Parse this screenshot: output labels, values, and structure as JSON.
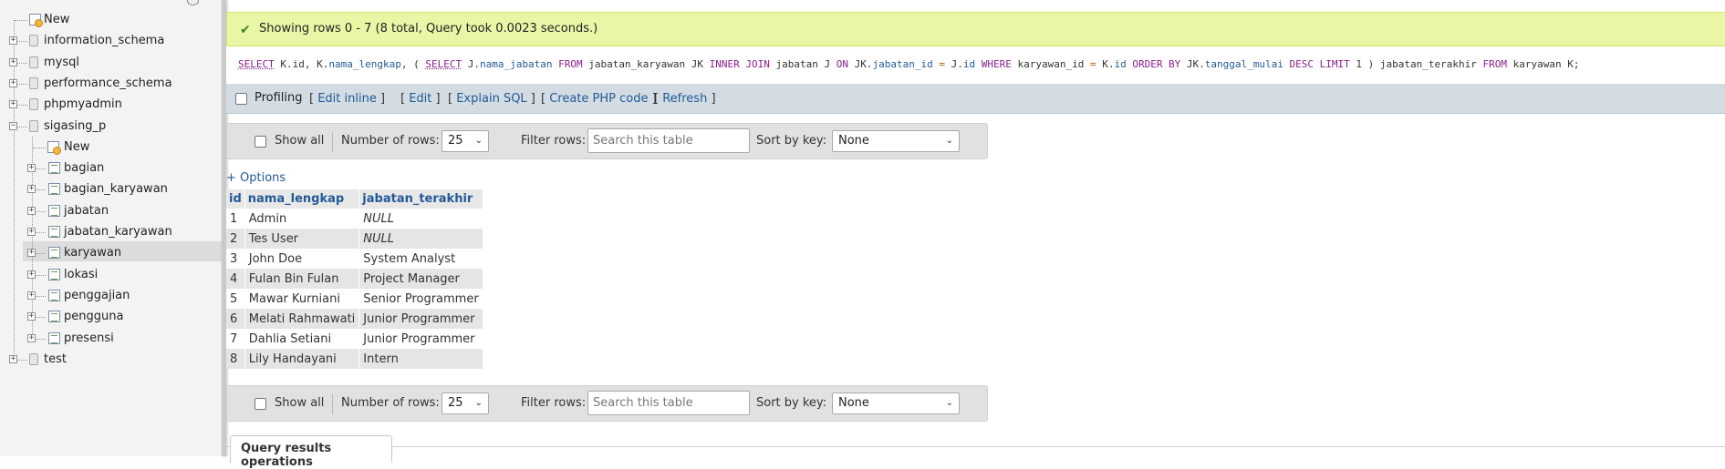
{
  "sidebar": {
    "items": [
      {
        "label": "New",
        "kind": "new",
        "level": 0
      },
      {
        "label": "information_schema",
        "kind": "db",
        "level": 0
      },
      {
        "label": "mysql",
        "kind": "db",
        "level": 0
      },
      {
        "label": "performance_schema",
        "kind": "db",
        "level": 0
      },
      {
        "label": "phpmyadmin",
        "kind": "db",
        "level": 0
      },
      {
        "label": "sigasing_p",
        "kind": "db",
        "level": 0,
        "expanded": true
      },
      {
        "label": "New",
        "kind": "new",
        "level": 1
      },
      {
        "label": "bagian",
        "kind": "table",
        "level": 1
      },
      {
        "label": "bagian_karyawan",
        "kind": "table",
        "level": 1
      },
      {
        "label": "jabatan",
        "kind": "table",
        "level": 1
      },
      {
        "label": "jabatan_karyawan",
        "kind": "table",
        "level": 1
      },
      {
        "label": "karyawan",
        "kind": "table",
        "level": 1,
        "selected": true
      },
      {
        "label": "lokasi",
        "kind": "table",
        "level": 1
      },
      {
        "label": "penggajian",
        "kind": "table",
        "level": 1
      },
      {
        "label": "pengguna",
        "kind": "table",
        "level": 1
      },
      {
        "label": "presensi",
        "kind": "table",
        "level": 1
      },
      {
        "label": "test",
        "kind": "db",
        "level": 0
      }
    ]
  },
  "result": {
    "message": "Showing rows 0 - 7 (8 total, Query took 0.0023 seconds.)"
  },
  "sql": {
    "tokens": [
      {
        "t": "SELECT",
        "c": "kw-u"
      },
      {
        "t": " K.id, K.",
        "c": ""
      },
      {
        "t": "nama_lengkap",
        "c": "col"
      },
      {
        "t": ", ( ",
        "c": ""
      },
      {
        "t": "SELECT",
        "c": "kw-u"
      },
      {
        "t": " J.",
        "c": ""
      },
      {
        "t": "nama_jabatan",
        "c": "col"
      },
      {
        "t": " FROM",
        "c": "kw"
      },
      {
        "t": " jabatan_karyawan JK ",
        "c": ""
      },
      {
        "t": "INNER JOIN",
        "c": "kw"
      },
      {
        "t": " jabatan J ",
        "c": ""
      },
      {
        "t": "ON",
        "c": "kw"
      },
      {
        "t": " JK.",
        "c": ""
      },
      {
        "t": "jabatan_id",
        "c": "col"
      },
      {
        "t": " = ",
        "c": "op"
      },
      {
        "t": "J.",
        "c": ""
      },
      {
        "t": "id",
        "c": "col"
      },
      {
        "t": " WHERE",
        "c": "kw"
      },
      {
        "t": " karyawan_id ",
        "c": ""
      },
      {
        "t": "=",
        "c": "op"
      },
      {
        "t": " K.",
        "c": ""
      },
      {
        "t": "id",
        "c": "col"
      },
      {
        "t": " ORDER BY",
        "c": "kw"
      },
      {
        "t": " JK.",
        "c": ""
      },
      {
        "t": "tanggal_mulai",
        "c": "col"
      },
      {
        "t": " DESC",
        "c": "kw"
      },
      {
        "t": " LIMIT",
        "c": "kw"
      },
      {
        "t": " 1 ) jabatan_terakhir ",
        "c": ""
      },
      {
        "t": "FROM",
        "c": "kw"
      },
      {
        "t": " karyawan K;",
        "c": ""
      }
    ]
  },
  "profiling": {
    "label": "Profiling",
    "links": [
      {
        "text": "Edit inline"
      },
      {
        "text": "Edit"
      },
      {
        "text": "Explain SQL"
      },
      {
        "text": "Create PHP code"
      },
      {
        "text": "Refresh"
      }
    ]
  },
  "nav_controls": {
    "show_all": "Show all",
    "rows_label": "Number of rows:",
    "rows_value": "25",
    "filter_label": "Filter rows:",
    "filter_placeholder": "Search this table",
    "sort_label": "Sort by key:",
    "sort_value": "None"
  },
  "options_link": "+ Options",
  "table": {
    "columns": [
      "id",
      "nama_lengkap",
      "jabatan_terakhir"
    ],
    "rows": [
      [
        "1",
        "Admin",
        "NULL"
      ],
      [
        "2",
        "Tes User",
        "NULL"
      ],
      [
        "3",
        "John Doe",
        "System Analyst"
      ],
      [
        "4",
        "Fulan Bin Fulan",
        "Project Manager"
      ],
      [
        "5",
        "Mawar Kurniani",
        "Senior Programmer"
      ],
      [
        "6",
        "Melati Rahmawati",
        "Junior Programmer"
      ],
      [
        "7",
        "Dahlia Setiani",
        "Junior Programmer"
      ],
      [
        "8",
        "Lily Handayani",
        "Intern"
      ]
    ]
  },
  "operations_label": "Query results operations",
  "colors": {
    "success_bg": "#ebf5a6",
    "link": "#235a96",
    "profiling_bg": "#d3dce3",
    "sidebar_bg": "#f3f3f3"
  }
}
